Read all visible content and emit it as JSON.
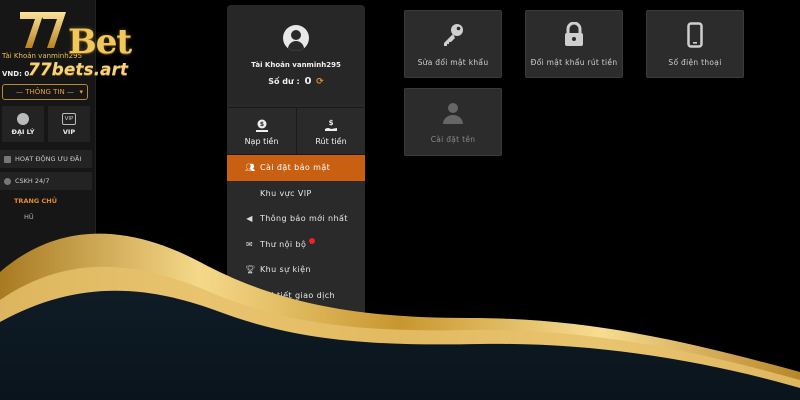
{
  "brand": {
    "logo_text": "Bet",
    "domain": "77bets.art",
    "colors": {
      "gold": "#f1c95a",
      "accent_orange": "#c95f10",
      "panel": "#2a2a2a",
      "background": "#000000"
    }
  },
  "sidebar": {
    "account_label": "Tài Khoản vanminh295",
    "currency_line": "VND: 0",
    "info_dropdown": "— THÔNG TIN —",
    "tiles": [
      {
        "label": "ĐẠI LÝ",
        "icon": "agent-icon"
      },
      {
        "label": "VIP",
        "icon": "vip-icon"
      }
    ],
    "rows": [
      {
        "label": "HOẠT ĐỘNG ƯU ĐÃI",
        "icon": "gift-icon"
      },
      {
        "label": "CSKH 24/7",
        "icon": "headset-icon"
      }
    ],
    "section_title": "TRANG CHỦ",
    "sub_item": "HŨ"
  },
  "profile": {
    "username": "Tài Khoản vanminh295",
    "balance_label": "Số dư :",
    "balance_value": "0",
    "actions": [
      {
        "label": "Nạp tiền",
        "icon": "deposit-icon"
      },
      {
        "label": "Rút tiền",
        "icon": "withdraw-icon"
      }
    ],
    "menu": [
      {
        "label": "Cài đặt bảo mật",
        "icon": "user-cog-icon",
        "active": true
      },
      {
        "label": "Khu vực VIP",
        "icon": "vip-icon",
        "active": false
      },
      {
        "label": "Thông báo mới nhất",
        "icon": "megaphone-icon",
        "active": false
      },
      {
        "label": "Thư nội bộ",
        "icon": "mail-icon",
        "active": false,
        "badge": "0"
      },
      {
        "label": "Khu sự kiện",
        "icon": "trophy-icon",
        "active": false
      },
      {
        "label": "Chi tiết giao dịch",
        "icon": "clipboard-icon",
        "active": false
      }
    ]
  },
  "security_options": [
    {
      "label": "Sửa đổi mật khẩu",
      "icon": "key-icon"
    },
    {
      "label": "Đổi mật khẩu rút tiền",
      "icon": "lock-icon"
    },
    {
      "label": "Số điện thoại",
      "icon": "phone-icon"
    },
    {
      "label": "Cài đặt tên",
      "icon": "user-icon"
    }
  ]
}
